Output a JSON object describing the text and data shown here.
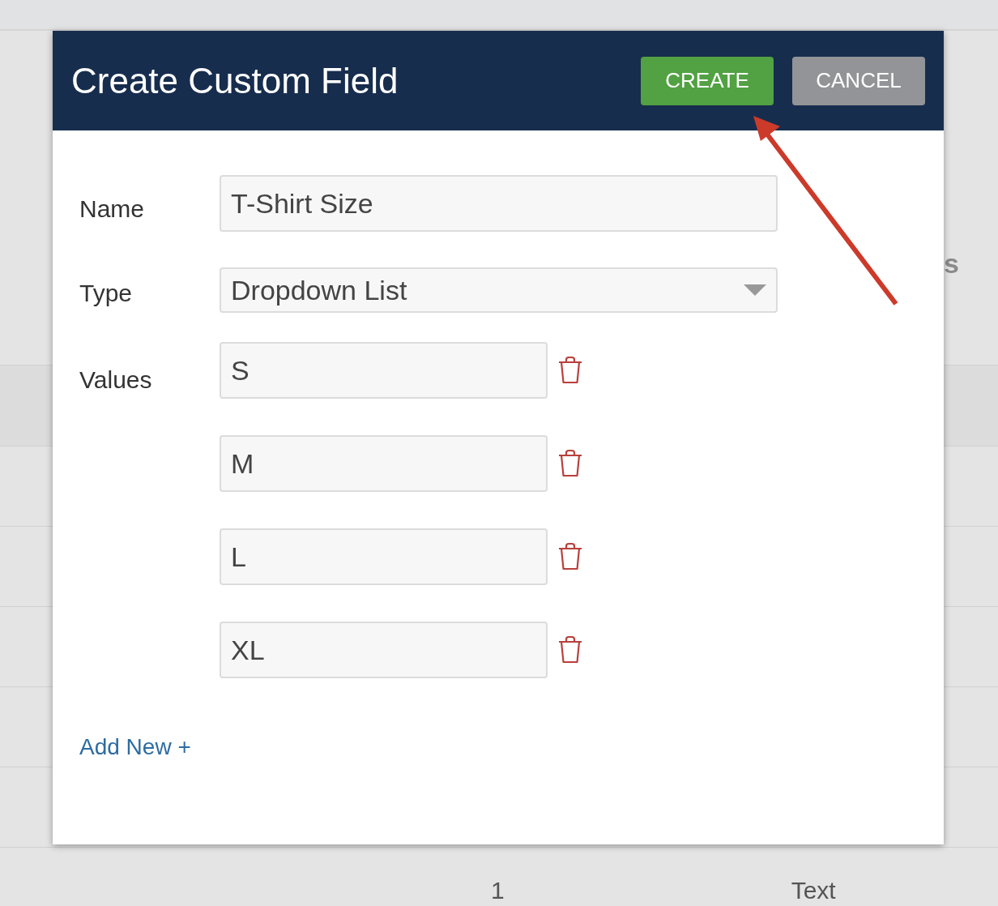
{
  "background": {
    "right_header_fragment": "s",
    "footer_cells": [
      "1",
      "Text"
    ]
  },
  "dialog": {
    "title": "Create Custom Field",
    "buttons": [
      {
        "label": "CREATE",
        "kind": "primary"
      },
      {
        "label": "CANCEL",
        "kind": "secondary"
      }
    ],
    "name": {
      "label": "Name",
      "value": "T-Shirt Size"
    },
    "type": {
      "label": "Type",
      "value": "Dropdown List"
    },
    "values": {
      "label": "Values",
      "items": [
        "S",
        "M",
        "L",
        "XL"
      ]
    },
    "add_link": "Add New +"
  }
}
